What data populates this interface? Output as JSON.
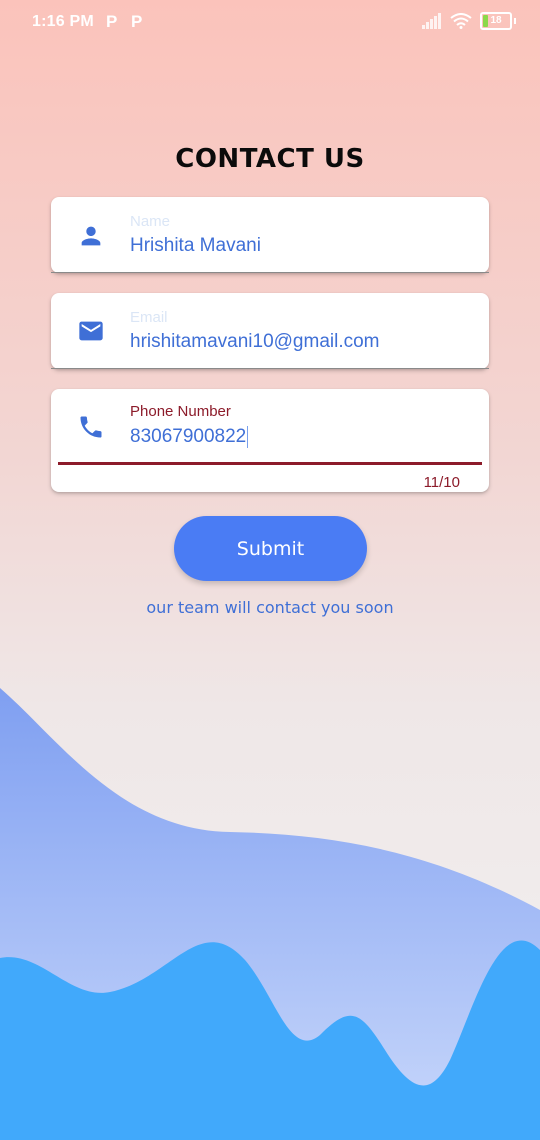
{
  "status_bar": {
    "time": "1:16 PM",
    "notification_icons": [
      "P",
      "P"
    ],
    "battery_level": "18"
  },
  "page": {
    "title": "CONTACT US"
  },
  "form": {
    "name": {
      "label": "Name",
      "value": "Hrishita Mavani",
      "icon": "person-icon"
    },
    "email": {
      "label": "Email",
      "value": "hrishitamavani10@gmail.com",
      "icon": "email-icon"
    },
    "phone": {
      "label": "Phone Number",
      "value": "83067900822",
      "icon": "phone-icon",
      "counter": "11/10"
    },
    "submit_label": "Submit",
    "hint": "our team will contact you soon"
  },
  "colors": {
    "accent": "#4a7cf4",
    "error": "#8c1b2a",
    "wave_light": "#8aa8f2",
    "wave_dark": "#41a9fb"
  }
}
